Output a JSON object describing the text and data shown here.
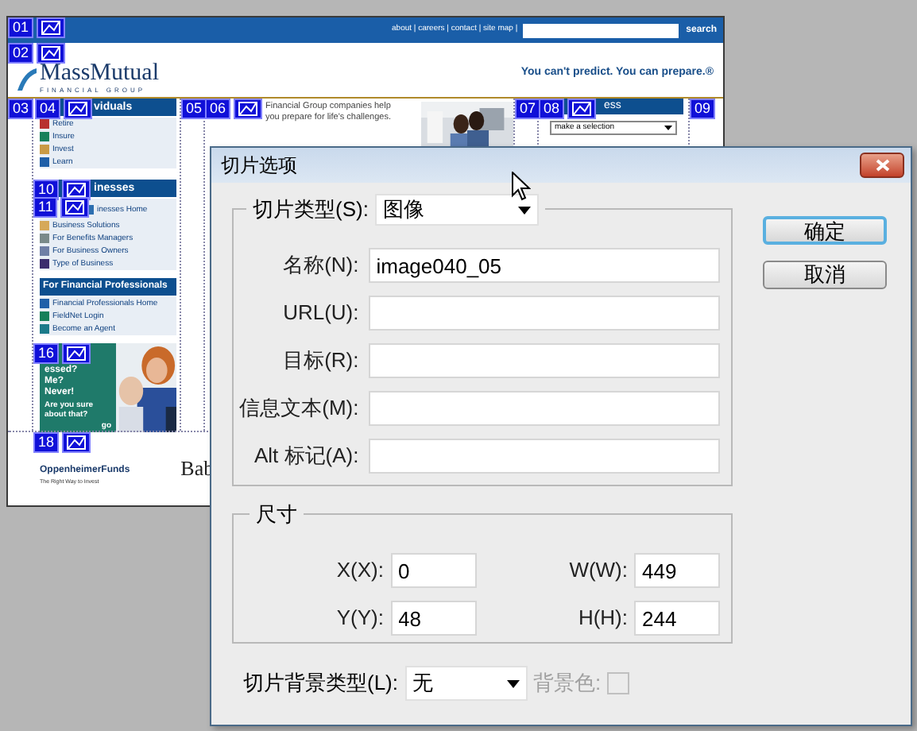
{
  "page": {
    "top_links": "about | careers | contact | site map |",
    "search_button": "search",
    "logo": "MassMutual",
    "logo_sub": "FINANCIAL GROUP",
    "tagline": "You can't predict. You can prepare.®",
    "individuals": {
      "title": "viduals",
      "items": [
        {
          "label": "Retire",
          "color": "#b8312f"
        },
        {
          "label": "Insure",
          "color": "#17805a"
        },
        {
          "label": "Invest",
          "color": "#c99a45"
        },
        {
          "label": "Learn",
          "color": "#1f5fa8"
        }
      ]
    },
    "business": {
      "title": "inesses",
      "items": [
        {
          "label": "inesses Home",
          "color": "#2d6fb0"
        },
        {
          "label": "Business Solutions",
          "color": "#d6a95a"
        },
        {
          "label": "For Benefits Managers",
          "color": "#7a8a8a"
        },
        {
          "label": "For Business Owners",
          "color": "#6f7fa6"
        },
        {
          "label": "Type of Business",
          "color": "#3b2e6e"
        }
      ]
    },
    "professionals": {
      "title": "For Financial Professionals",
      "items": [
        {
          "label": "Financial Professionals Home",
          "color": "#1f5fa8"
        },
        {
          "label": "FieldNet Login",
          "color": "#17805a"
        },
        {
          "label": "Become an Agent",
          "color": "#1a7a8a"
        }
      ]
    },
    "promo": {
      "lines": [
        "essed?",
        "Me?",
        "Never!"
      ],
      "question": "Are you sure about that?",
      "go": "go"
    },
    "intro": "Financial Group companies help you prepare for life's challenges.",
    "right_title": "ess",
    "select": "make a selection",
    "footer_logo": "OppenheimerFunds",
    "footer_sub": "The Right Way to Invest",
    "footer_text": "Bab",
    "slices": [
      {
        "number": "01",
        "icon": true
      },
      {
        "number": "02",
        "icon": true
      },
      {
        "number": "03",
        "icon": false
      },
      {
        "number": "04",
        "icon": true
      },
      {
        "number": "05",
        "icon": false
      },
      {
        "number": "06",
        "icon": true
      },
      {
        "number": "07",
        "icon": false
      },
      {
        "number": "08",
        "icon": true
      },
      {
        "number": "09",
        "icon": false
      },
      {
        "number": "10",
        "icon": true
      },
      {
        "number": "11",
        "icon": true
      },
      {
        "number": "16",
        "icon": true
      },
      {
        "number": "18",
        "icon": true
      }
    ]
  },
  "dialog": {
    "title": "切片选项",
    "slice_type": {
      "label": "切片类型(S):",
      "value": "图像"
    },
    "fields": [
      {
        "label": "名称(N):",
        "value": "image040_05"
      },
      {
        "label": "URL(U):"
      },
      {
        "label": "目标(R):"
      },
      {
        "label": "信息文本(M):"
      },
      {
        "label": "Alt 标记(A):"
      }
    ],
    "buttons": [
      {
        "label": "确定",
        "default": true
      },
      {
        "label": "取消",
        "default": false
      }
    ],
    "dimensions": {
      "title": "尺寸",
      "fields": [
        {
          "label": "X(X):",
          "value": "0"
        },
        {
          "label": "W(W):",
          "value": "449"
        },
        {
          "label": "Y(Y):",
          "value": "48"
        },
        {
          "label": "H(H):",
          "value": "244"
        }
      ]
    },
    "background": {
      "label": "切片背景类型(L):",
      "value": "无",
      "color_label": "背景色:",
      "color_disabled": true
    }
  }
}
